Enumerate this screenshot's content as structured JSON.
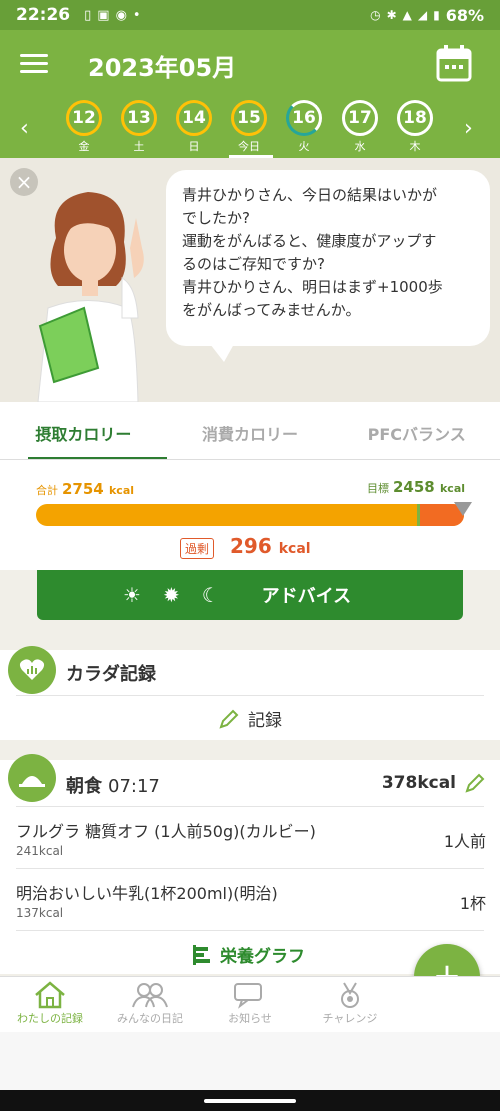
{
  "status": {
    "time": "22:26",
    "battery": "68%"
  },
  "header": {
    "month": "2023年05月"
  },
  "days": [
    {
      "num": "12",
      "wd": "金"
    },
    {
      "num": "13",
      "wd": "土"
    },
    {
      "num": "14",
      "wd": "日"
    },
    {
      "num": "15",
      "wd": "今日"
    },
    {
      "num": "16",
      "wd": "火"
    },
    {
      "num": "17",
      "wd": "水"
    },
    {
      "num": "18",
      "wd": "木"
    }
  ],
  "coach": {
    "message": "青井ひかりさん、今日の結果はいかがでしたか?\n運動をがんばると、健康度がアップするのはご存知ですか?\n青井ひかりさん、明日はまず+1000歩をがんばってみませんか。",
    "line1": "青井ひかりさん、今日の結果はいかが",
    "line2": "でしたか?",
    "line3": "運動をがんばると、健康度がアップす",
    "line4": "るのはご存知ですか?",
    "line5": "青井ひかりさん、明日はまず+1000歩",
    "line6": "をがんばってみませんか。"
  },
  "tabs": {
    "intake": "摂取カロリー",
    "burn": "消費カロリー",
    "pfc": "PFCバランス"
  },
  "calories": {
    "total_label": "合計",
    "total_value": "2754",
    "target_label": "目標",
    "target_value": "2458",
    "unit": "kcal",
    "over_label": "過剰",
    "over_value": "296",
    "intake_fraction": 1.12,
    "target_fraction": 0.89
  },
  "advice": {
    "label": "アドバイス"
  },
  "body_record": {
    "title": "カラダ記録",
    "record_label": "記録"
  },
  "meal": {
    "title": "朝食",
    "time": "07:17",
    "kcal": "378kcal",
    "items": [
      {
        "name": "フルグラ 糖質オフ (1人前50g)(カルビー)",
        "kcal": "241kcal",
        "qty": "1人前"
      },
      {
        "name": "明治おいしい牛乳(1杯200ml)(明治)",
        "kcal": "137kcal",
        "qty": "1杯"
      }
    ],
    "graph_link": "栄養グラフ"
  },
  "nav": {
    "my_record": "わたしの記録",
    "diary": "みんなの日記",
    "news": "お知らせ",
    "challenge": "チャレンジ"
  },
  "colors": {
    "brand": "#7cb342",
    "dark_green": "#2e8b2e",
    "orange": "#f4a300",
    "over": "#e05a2b"
  }
}
